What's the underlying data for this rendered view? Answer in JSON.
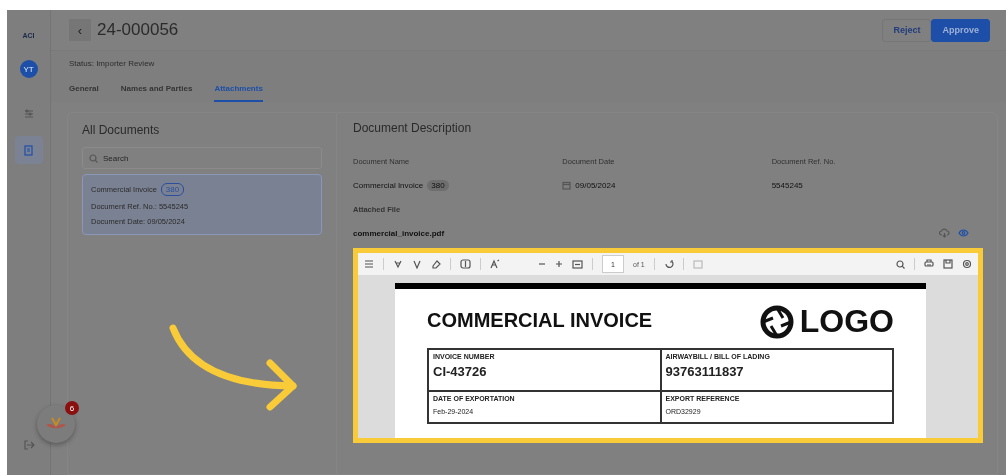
{
  "sidebar": {
    "logo": "ACI",
    "avatar": "YT",
    "nav_items": [
      {
        "selected": false
      },
      {
        "selected": true
      }
    ],
    "chat_badge": "6"
  },
  "header": {
    "back": "‹",
    "title": "24-000056",
    "buttons": [
      {
        "label": "Reject",
        "kind": "secondary"
      },
      {
        "label": "Approve",
        "kind": "primary"
      }
    ]
  },
  "status": "Status: Importer Review",
  "tabs": [
    {
      "label": "General",
      "selected": false
    },
    {
      "label": "Names and Parties",
      "selected": false
    },
    {
      "label": "Attachments",
      "selected": true
    }
  ],
  "documents": {
    "title": "All Documents",
    "search": {
      "placeholder": "Search"
    },
    "items": [
      {
        "name": "Commercial Invoice",
        "code": "380",
        "ref": "Document Ref. No.: 5545245",
        "date": "Document Date: 09/05/2024",
        "selected": true
      }
    ]
  },
  "description": {
    "title": "Document Description",
    "fields": [
      {
        "label": "Document Name",
        "value": "Commercial Invoice",
        "badge": "380",
        "kind": "badge"
      },
      {
        "label": "Document Date",
        "value": "09/05/2024",
        "kind": "date"
      },
      {
        "label": "Document Ref. No.",
        "value": "5545245",
        "kind": "text"
      }
    ],
    "attached_label": "Attached File",
    "file": "commercial_invoice.pdf"
  },
  "viewer": {
    "page": "1",
    "page_count": "of 1",
    "pdf": {
      "title": "COMMERCIAL INVOICE",
      "logo": "LOGO",
      "cells": [
        {
          "label": "INVOICE NUMBER",
          "value": "CI-43726",
          "kind": "large"
        },
        {
          "label": "AIRWAYBILL / BILL OF LADING",
          "value": "93763111837",
          "kind": "large"
        },
        {
          "label": "DATE OF EXPORTATION",
          "value": "Feb-29-2024",
          "kind": "small"
        },
        {
          "label": "EXPORT REFERENCE",
          "value": "ORD32929",
          "kind": "small"
        }
      ]
    }
  }
}
